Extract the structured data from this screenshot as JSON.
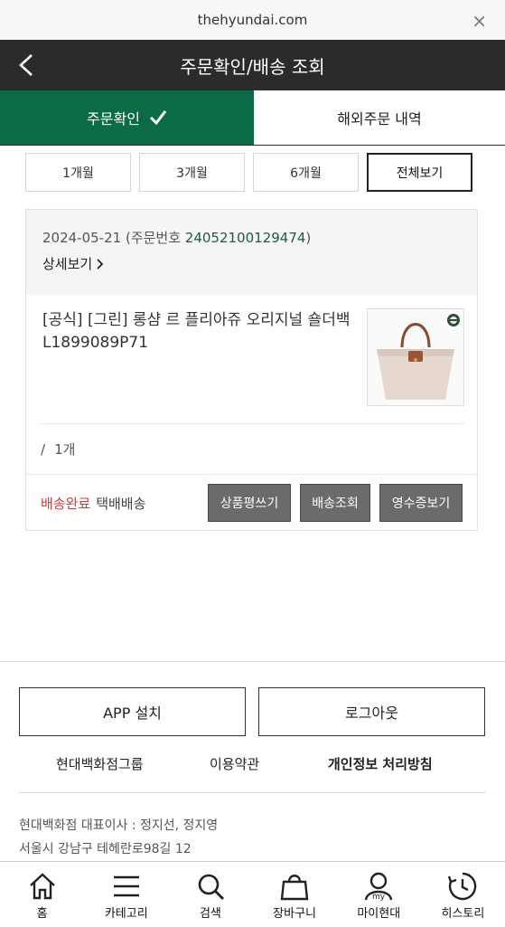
{
  "browser": {
    "url": "thehyundai.com",
    "close_glyph": "×"
  },
  "header": {
    "title": "주문확인/배송 조회"
  },
  "tabs": [
    {
      "label": "주문확인",
      "active": true
    },
    {
      "label": "해외주문 내역",
      "active": false
    }
  ],
  "periods": [
    {
      "label": "1개월",
      "selected": false
    },
    {
      "label": "3개월",
      "selected": false
    },
    {
      "label": "6개월",
      "selected": false
    },
    {
      "label": "전체보기",
      "selected": true
    }
  ],
  "order": {
    "date": "2024-05-21",
    "order_prefix": "(주문번호 ",
    "order_number": "24052100129474",
    "order_suffix": ")",
    "detail_label": "상세보기",
    "product_name": "[공식] [그린] 롱샴 르 플리아쥬 오리지널 숄더백 L1899089P71",
    "quantity_slash": "/",
    "quantity": "1개",
    "status": "배송완료",
    "delivery_type": "택배배송",
    "buttons": [
      "상품평쓰기",
      "배송조회",
      "영수증보기"
    ]
  },
  "footer": {
    "app_install": "APP 설치",
    "logout": "로그아웃",
    "links": [
      "현대백화점그룹",
      "이용약관",
      "개인정보 처리방침"
    ],
    "ceo": "현대백화점 대표이사 : 정지선, 정지영",
    "address": "서울시 강남구 테헤란로98길 12"
  },
  "bottom_nav": [
    {
      "label": "홈",
      "icon": "home-icon"
    },
    {
      "label": "카테고리",
      "icon": "menu-icon"
    },
    {
      "label": "검색",
      "icon": "search-icon"
    },
    {
      "label": "장바구니",
      "icon": "shopping-bag-icon"
    },
    {
      "label": "마이현대",
      "icon": "my-icon",
      "icon_text": "my"
    },
    {
      "label": "히스토리",
      "icon": "history-icon"
    }
  ],
  "colors": {
    "header_bg": "#2b2b2b",
    "active_tab": "#0b6b47",
    "status_red": "#d23b3b",
    "order_number": "#1f5c45",
    "action_button": "#6b6b6b"
  }
}
